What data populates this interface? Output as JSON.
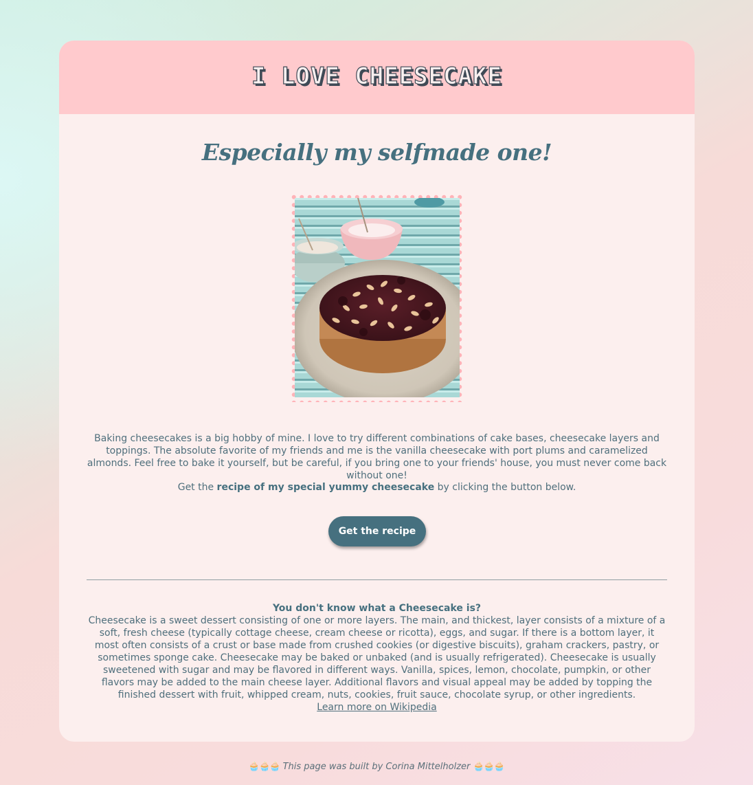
{
  "header": {
    "title": "I love cheesecake"
  },
  "subtitle": "Especially my selfmade one!",
  "intro": {
    "paragraph": "Baking cheesecakes is a big hobby of mine. I love to try different combinations of cake bases, cheesecake layers and toppings. The absolute favorite of my friends and me is the vanilla cheesecake with port plums and caramelized almonds. Feel free to bake it yourself, but be careful, if you bring one to your friends' house, you must never come back without one!",
    "cta_prefix": "Get the ",
    "cta_bold": "recipe of my special yummy cheesecake",
    "cta_suffix": " by clicking the button below."
  },
  "button": {
    "label": "Get the recipe"
  },
  "info": {
    "heading": "You don't know what a Cheesecake is?",
    "text": "Cheesecake is a sweet dessert consisting of one or more layers. The main, and thickest, layer consists of a mixture of a soft, fresh cheese (typically cottage cheese, cream cheese or ricotta), eggs, and sugar. If there is a bottom layer, it most often consists of a crust or base made from crushed cookies (or digestive biscuits), graham crackers, pastry, or sometimes sponge cake. Cheesecake may be baked or unbaked (and is usually refrigerated). Cheesecake is usually sweetened with sugar and may be flavored in different ways. Vanilla, spices, lemon, chocolate, pumpkin, or other flavors may be added to the main cheese layer. Additional flavors and visual appeal may be added by topping the finished dessert with fruit, whipped cream, nuts, cookies, fruit sauce, chocolate syrup, or other ingredients.",
    "link_label": "Learn more on Wikipedia"
  },
  "footer": {
    "icons_left": "🧁🧁🧁",
    "text": "This page was built by Corina Mittelholzer",
    "icons_right": "🧁🧁🧁"
  },
  "colors": {
    "header_bg": "#ffcacd",
    "card_bg": "#fcefee",
    "accent": "#46707f",
    "frame_dots": "#ffb3b8"
  },
  "icons": {
    "footer_decoration": "cupcake-icon"
  }
}
